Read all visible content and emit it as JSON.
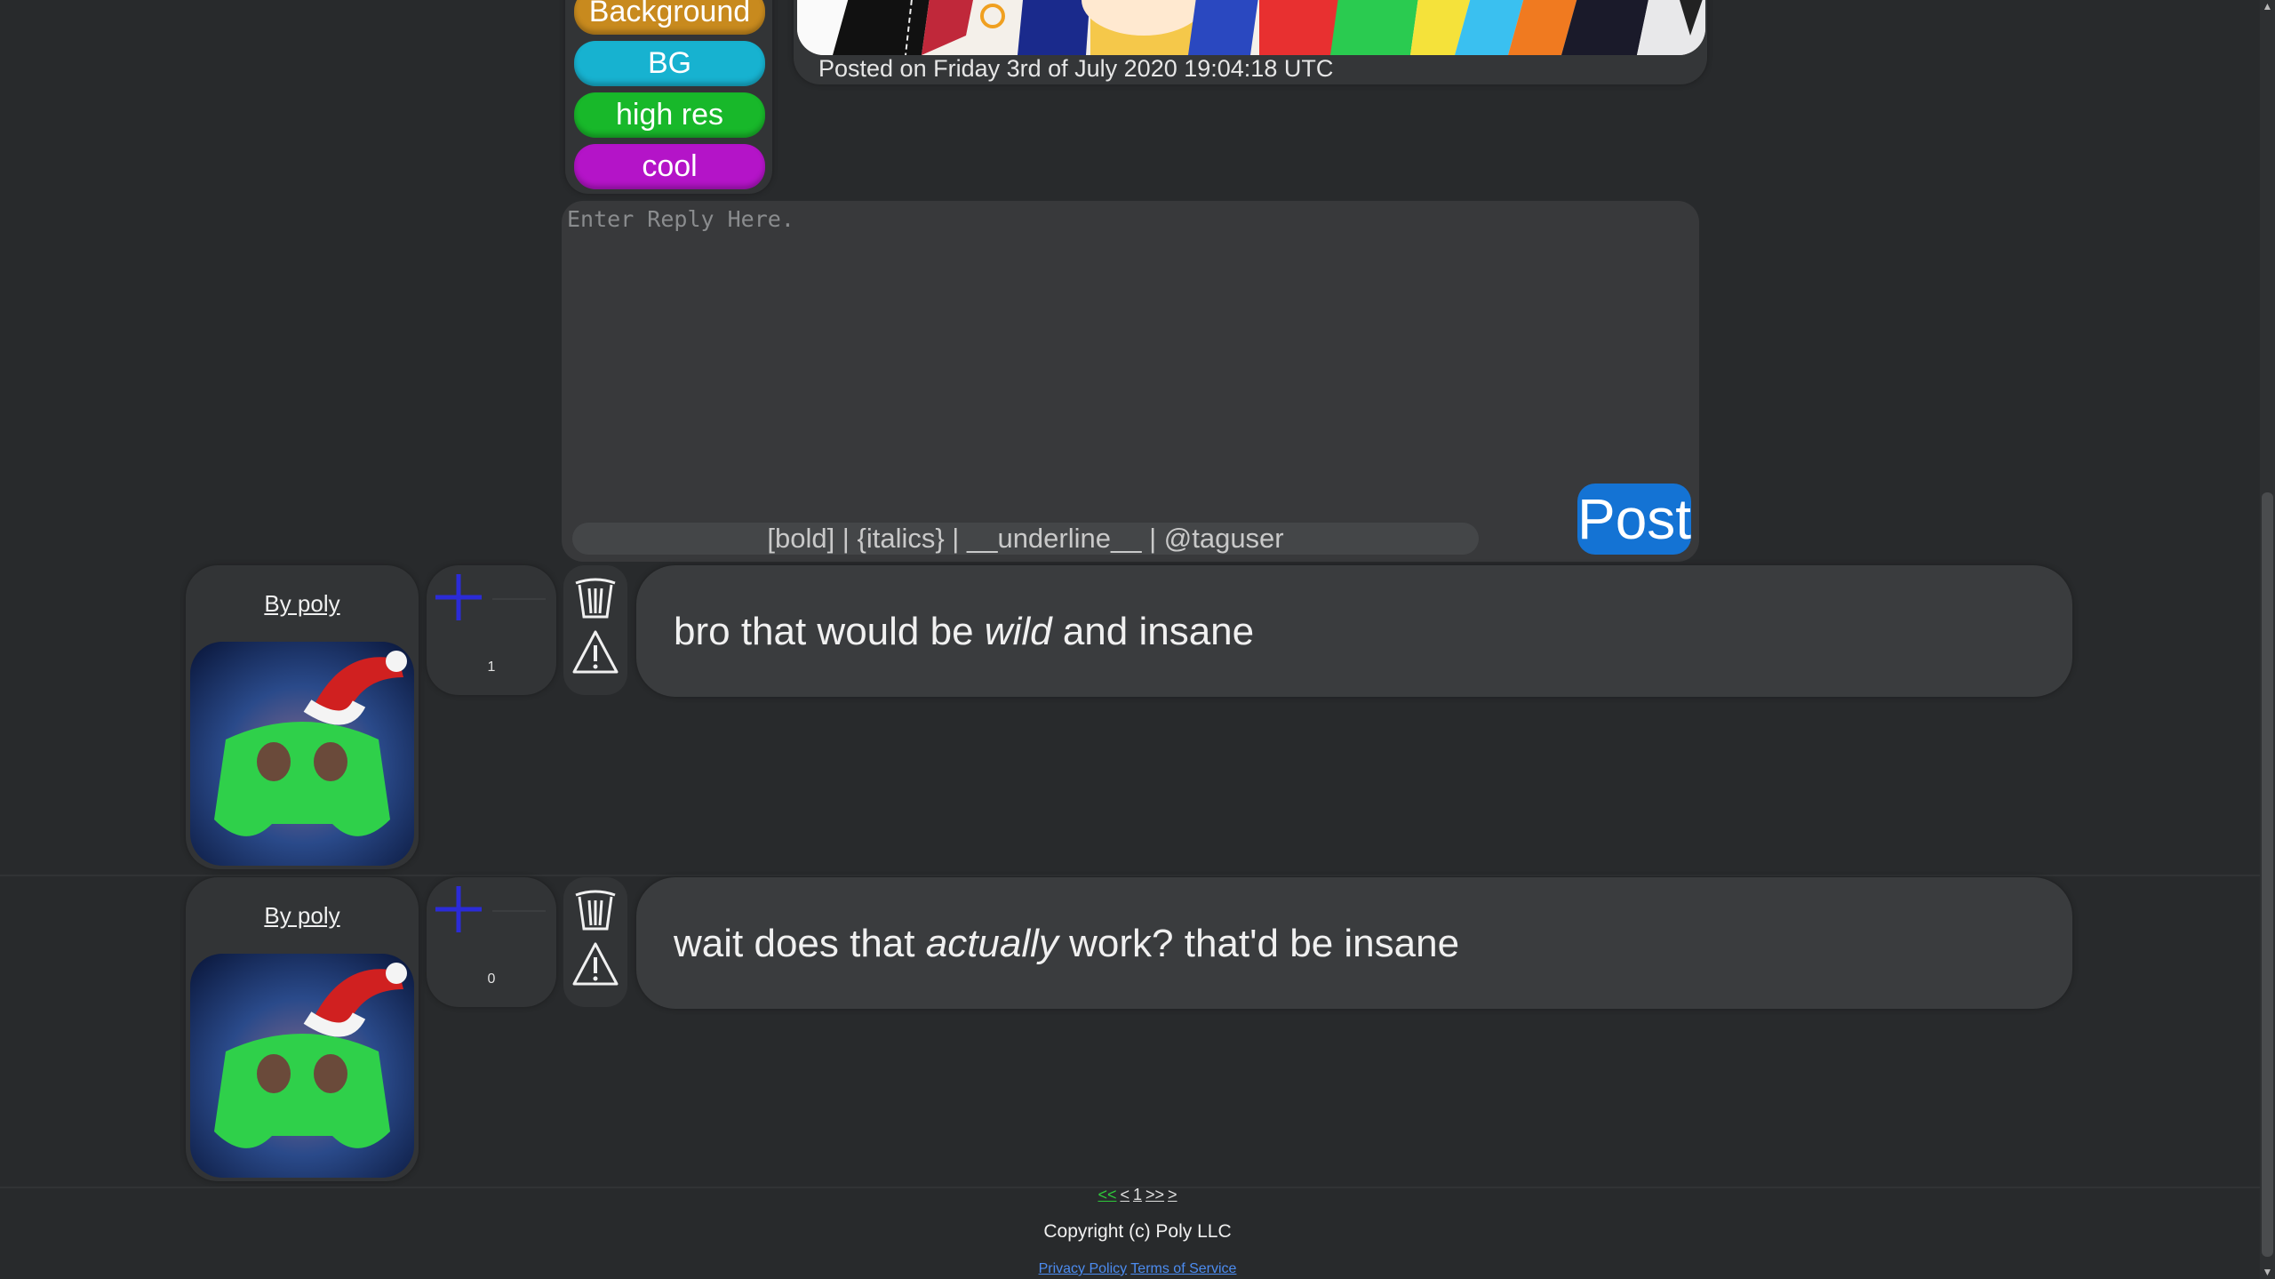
{
  "tags": [
    "Background",
    "BG",
    "high res",
    "cool"
  ],
  "post": {
    "posted_on": "Posted on Friday 3rd of July 2020 19:04:18 UTC"
  },
  "reply": {
    "placeholder": "Enter Reply Here.",
    "formatting_hint": "[bold] | {italics} | __underline__ | @taguser",
    "post_label": "Post"
  },
  "comments": [
    {
      "author": "By poly",
      "votes": "1",
      "text_parts": [
        "bro that would be ",
        "wild",
        " and ",
        "insane"
      ]
    },
    {
      "author": "By poly",
      "votes": "0",
      "text_parts": [
        "wait does that ",
        "actually",
        " work? that'd be ",
        "insane"
      ]
    }
  ],
  "pagination": {
    "first": "<<",
    "prev": "<",
    "current": "1",
    "last": ">>",
    "next": ">"
  },
  "footer": {
    "copyright": "Copyright (c) Poly LLC",
    "privacy": "Privacy Policy",
    "terms": "Terms of Service"
  },
  "colors": {
    "tag_background": "#c88a1e",
    "tag_bg": "#17b2d0",
    "tag_high_res": "#18b82a",
    "tag_cool": "#b414c8",
    "post_button": "#1473d4",
    "vote_plus": "#2b2bd8"
  }
}
